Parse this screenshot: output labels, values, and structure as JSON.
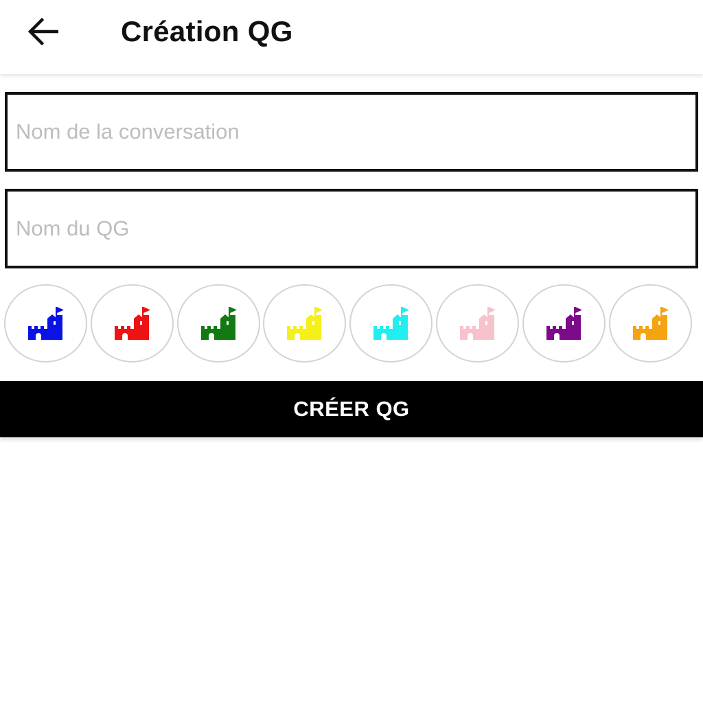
{
  "header": {
    "back_icon": "arrow-left-icon",
    "title": "Création QG"
  },
  "form": {
    "conversation_name": {
      "value": "",
      "placeholder": "Nom de la conversation"
    },
    "hq_name": {
      "value": "",
      "placeholder": "Nom du QG"
    }
  },
  "colors": {
    "icon": "castle-icon",
    "options": [
      {
        "name": "blue",
        "hex": "#0a12e6"
      },
      {
        "name": "red",
        "hex": "#ee1212"
      },
      {
        "name": "green",
        "hex": "#137a13"
      },
      {
        "name": "yellow",
        "hex": "#f5ef1a"
      },
      {
        "name": "cyan",
        "hex": "#22eef0"
      },
      {
        "name": "pink",
        "hex": "#f7c2cc"
      },
      {
        "name": "purple",
        "hex": "#7d0a8a"
      },
      {
        "name": "orange",
        "hex": "#f5a30f"
      }
    ]
  },
  "actions": {
    "create_label": "CRÉER QG"
  }
}
